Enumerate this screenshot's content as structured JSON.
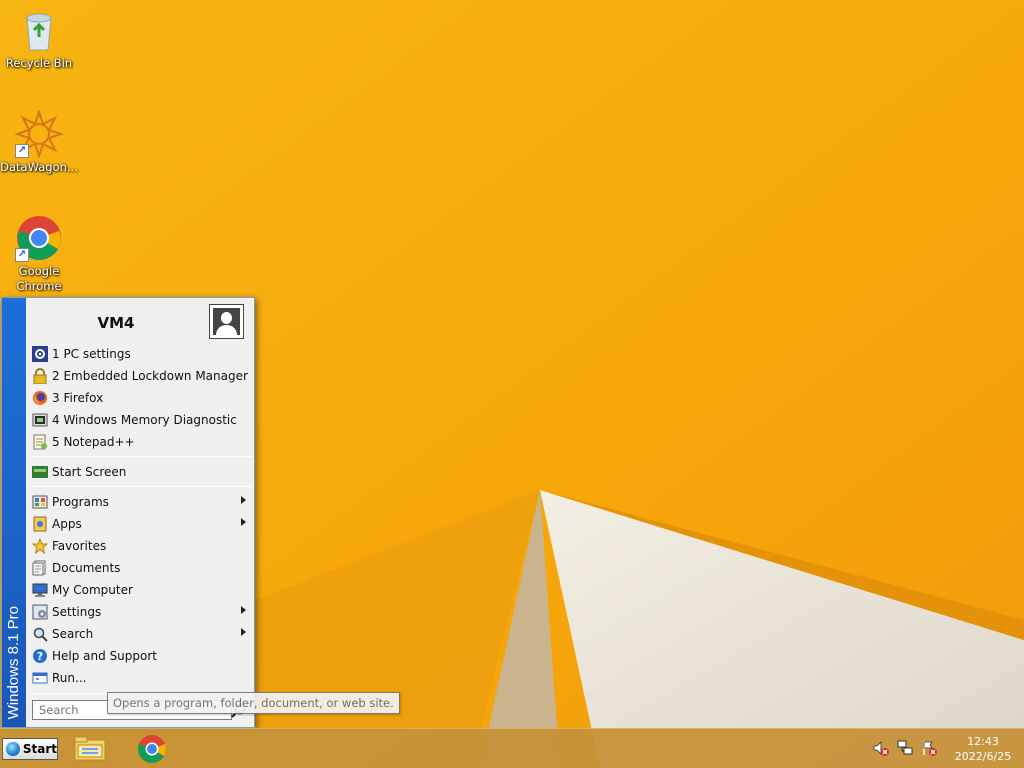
{
  "desktop": {
    "icons": [
      {
        "label": "Recycle Bin",
        "icon": "recycle-bin-icon"
      },
      {
        "label": "DataWagon...",
        "icon": "datawagon-icon",
        "shortcut": true
      },
      {
        "label": "Google Chrome",
        "icon": "chrome-icon",
        "shortcut": true
      }
    ]
  },
  "start_menu": {
    "side_banner": "Windows 8.1 Pro",
    "user_name": "VM4",
    "recent": [
      {
        "label": "1 PC settings",
        "icon": "gear-icon"
      },
      {
        "label": "2 Embedded Lockdown Manager",
        "icon": "lock-icon"
      },
      {
        "label": "3 Firefox",
        "icon": "firefox-icon"
      },
      {
        "label": "4 Windows Memory Diagnostic",
        "icon": "memory-diagnostic-icon"
      },
      {
        "label": "5 Notepad++",
        "icon": "notepad-icon"
      }
    ],
    "start_screen": {
      "label": "Start Screen",
      "icon": "start-screen-icon"
    },
    "items": [
      {
        "label": "Programs",
        "icon": "programs-icon",
        "submenu": true
      },
      {
        "label": "Apps",
        "icon": "apps-icon",
        "submenu": true
      },
      {
        "label": "Favorites",
        "icon": "star-icon",
        "submenu": false
      },
      {
        "label": "Documents",
        "icon": "documents-icon",
        "submenu": false
      },
      {
        "label": "My Computer",
        "icon": "computer-icon",
        "submenu": false
      },
      {
        "label": "Settings",
        "icon": "settings-icon",
        "submenu": true
      },
      {
        "label": "Search",
        "icon": "search-icon",
        "submenu": true
      },
      {
        "label": "Help and Support",
        "icon": "help-icon",
        "submenu": false
      },
      {
        "label": "Run...",
        "icon": "run-icon",
        "submenu": false
      }
    ],
    "search_placeholder": "Search",
    "tooltip": "Opens a program, folder, document, or web site."
  },
  "taskbar": {
    "start_label": "Start",
    "pinned": [
      "file-explorer-icon",
      "chrome-icon"
    ],
    "tray": [
      "volume-muted-icon",
      "network-icon",
      "action-center-icon"
    ],
    "clock_time": "12:43",
    "clock_date": "2022/6/25"
  },
  "colors": {
    "wallpaper": "#f4a90b",
    "banner": "#1e6fd9",
    "taskbar": "#c69238"
  }
}
